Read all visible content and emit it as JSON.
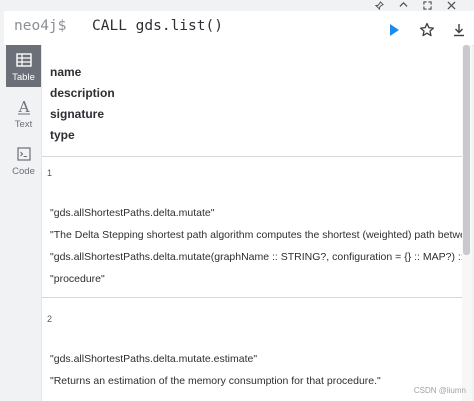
{
  "editor": {
    "prompt": "neo4j$",
    "query": "CALL gds.list()"
  },
  "views": [
    {
      "label": "Table"
    },
    {
      "label": "Text"
    },
    {
      "label": "Code"
    }
  ],
  "table": {
    "columns": [
      "name",
      "description",
      "signature",
      "type"
    ],
    "rows": [
      {
        "index": "1",
        "values": [
          "\"gds.allShortestPaths.delta.mutate\"",
          "\"The Delta Stepping shortest path algorithm computes the shortest (weighted) path betwe",
          "\"gds.allShortestPaths.delta.mutate(graphName :: STRING?, configuration = {} :: MAP?) ::",
          "\"procedure\""
        ]
      },
      {
        "index": "2",
        "values": [
          "\"gds.allShortestPaths.delta.mutate.estimate\"",
          "\"Returns an estimation of the memory consumption for that procedure.\""
        ]
      }
    ]
  },
  "watermark": "CSDN @liumn"
}
